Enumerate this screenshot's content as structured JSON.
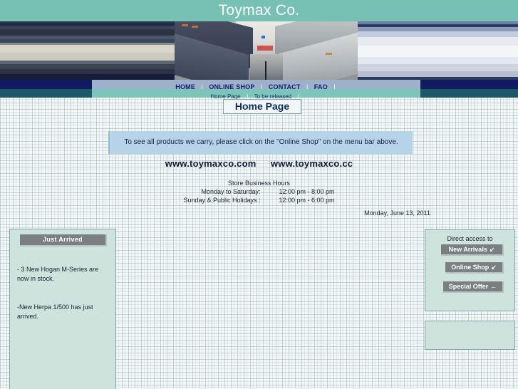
{
  "site": {
    "title": "Toymax Co."
  },
  "banner": {
    "image_name": "airplane-cabin-interior-photo"
  },
  "nav": {
    "separator": "|",
    "items": [
      {
        "label": "HOME"
      },
      {
        "label": "ONLINE SHOP"
      },
      {
        "label": "CONTACT"
      },
      {
        "label": "FAQ"
      }
    ]
  },
  "subnav": {
    "separator": "|",
    "items": [
      {
        "label": "Home Page"
      },
      {
        "label": "To be released"
      }
    ]
  },
  "page": {
    "title": "Home Page"
  },
  "announcement": {
    "text": "To see all products we carry, please click on the \"Online Shop\" on the menu bar above."
  },
  "urls": [
    {
      "label": "www.toymaxco.com"
    },
    {
      "label": "www.toymaxco.cc"
    }
  ],
  "hours": {
    "title": "Store Business Hours",
    "rows": [
      {
        "label": "Monday to Saturday:",
        "value": "12:00 pm - 8:00 pm"
      },
      {
        "label": "Sunday & Public Holidays :",
        "value": "12:00 pm - 6:00 pm"
      }
    ]
  },
  "date": {
    "text": "Monday, June 13, 2011"
  },
  "left_panel": {
    "header": "Just     Arrived",
    "news": [
      {
        "text": "- 3 New Hogan M-Series are now in stock."
      },
      {
        "text": "-New Herpa 1/500 has just arrived."
      }
    ]
  },
  "right_panel": {
    "label": "Direct access to",
    "buttons": [
      {
        "label": "New Arrivals",
        "glyph": "↙"
      },
      {
        "label": "Online Shop",
        "glyph": "↙"
      },
      {
        "label": "Special Offer",
        "glyph": "←"
      }
    ]
  },
  "colors": {
    "teal_header": "#77c0b4",
    "navy_bar": "#101a5f",
    "nav_bar": "#9db1cb",
    "subnav_bar": "#7dc4bb",
    "subnav_outer": "#1d5866",
    "announcement": "#b7d3e9",
    "panel": "#cfe3dd",
    "panel_border": "#7ea9a2",
    "button": "#7a7f82",
    "page_bg": "#f4f7f7"
  }
}
